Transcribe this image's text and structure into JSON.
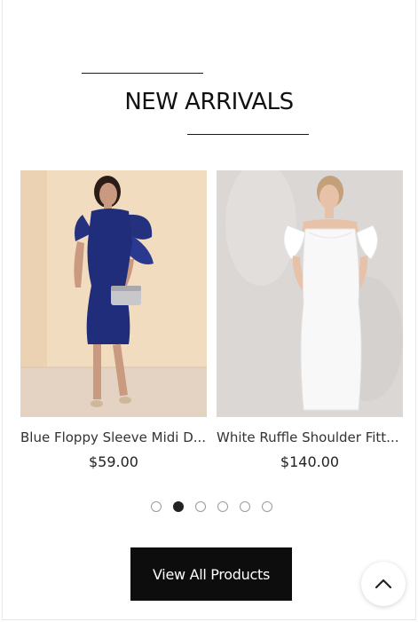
{
  "section": {
    "title": "NEW ARRIVALS"
  },
  "products": [
    {
      "name": "Blue Floppy Sleeve Midi D...",
      "price": "$59.00",
      "image_color": "#1f2d7a"
    },
    {
      "name": "White Ruffle Shoulder Fitt...",
      "price": "$140.00",
      "image_color": "#f5f5f5"
    }
  ],
  "carousel": {
    "page_count": 6,
    "active_page": 2
  },
  "cta": {
    "label": "View All Products"
  },
  "back_to_top": {
    "icon": "chevron-up-icon"
  },
  "colors": {
    "button_bg": "#0d0d0d",
    "accent_dark": "#222222"
  }
}
